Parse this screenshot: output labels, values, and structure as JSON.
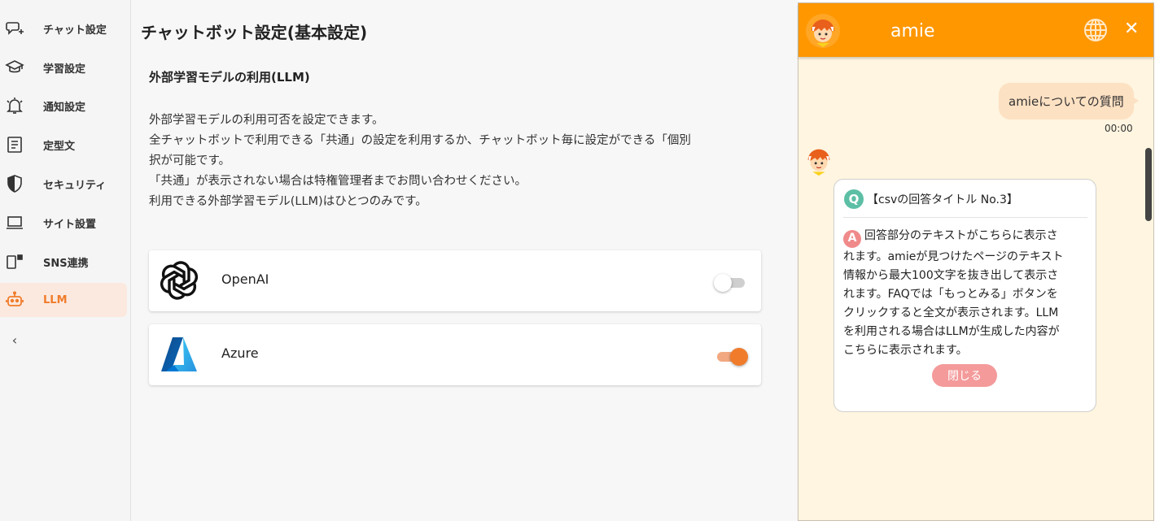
{
  "sidebar": {
    "items": [
      {
        "label": "チャット設定",
        "icon": "chat-settings-icon"
      },
      {
        "label": "学習設定",
        "icon": "graduation-cap-icon"
      },
      {
        "label": "通知設定",
        "icon": "bell-icon"
      },
      {
        "label": "定型文",
        "icon": "document-icon"
      },
      {
        "label": "セキュリティ",
        "icon": "shield-icon"
      },
      {
        "label": "サイト設置",
        "icon": "laptop-icon"
      },
      {
        "label": "SNS連携",
        "icon": "sns-icon"
      },
      {
        "label": "LLM",
        "icon": "robot-icon",
        "active": true
      }
    ],
    "collapse_icon": "chevron-left-icon"
  },
  "main": {
    "title": "チャットボット設定(基本設定)",
    "section_title": "外部学習モデルの利用(LLM)",
    "description": [
      "外部学習モデルの利用可否を設定できます。",
      "全チャットボットで利用できる「共通」の設定を利用するか、チャットボット毎に設定ができる「個別",
      "択が可能です。",
      "「共通」が表示されない場合は特権管理者までお問い合わせください。",
      "利用できる外部学習モデル(LLM)はひとつのみです。"
    ],
    "models": [
      {
        "name": "OpenAI",
        "enabled": false,
        "icon": "openai-logo-icon"
      },
      {
        "name": "Azure",
        "enabled": true,
        "icon": "azure-logo-icon"
      }
    ]
  },
  "chat": {
    "title": "amie",
    "user_message": "amieについての質問",
    "time": "00:00",
    "answer": {
      "q_badge": "Q",
      "question": "【csvの回答タイトル No.3】",
      "a_badge": "A",
      "lines": [
        "回答部分のテキストがこちらに表示さ",
        "れます。amieが見つけたページのテキスト",
        "情報から最大100文字を抜き出して表示さ",
        "れます。FAQでは「もっとみる」ボタンを",
        "クリックすると全文が表示されます。LLM",
        "を利用される場合はLLMが生成した内容が",
        "こちらに表示されます。"
      ],
      "close_label": "閉じる"
    },
    "close_symbol": "✕",
    "colors": {
      "header": "#ff9700",
      "background": "#fff5e0",
      "accent": "#f07c2b"
    }
  }
}
